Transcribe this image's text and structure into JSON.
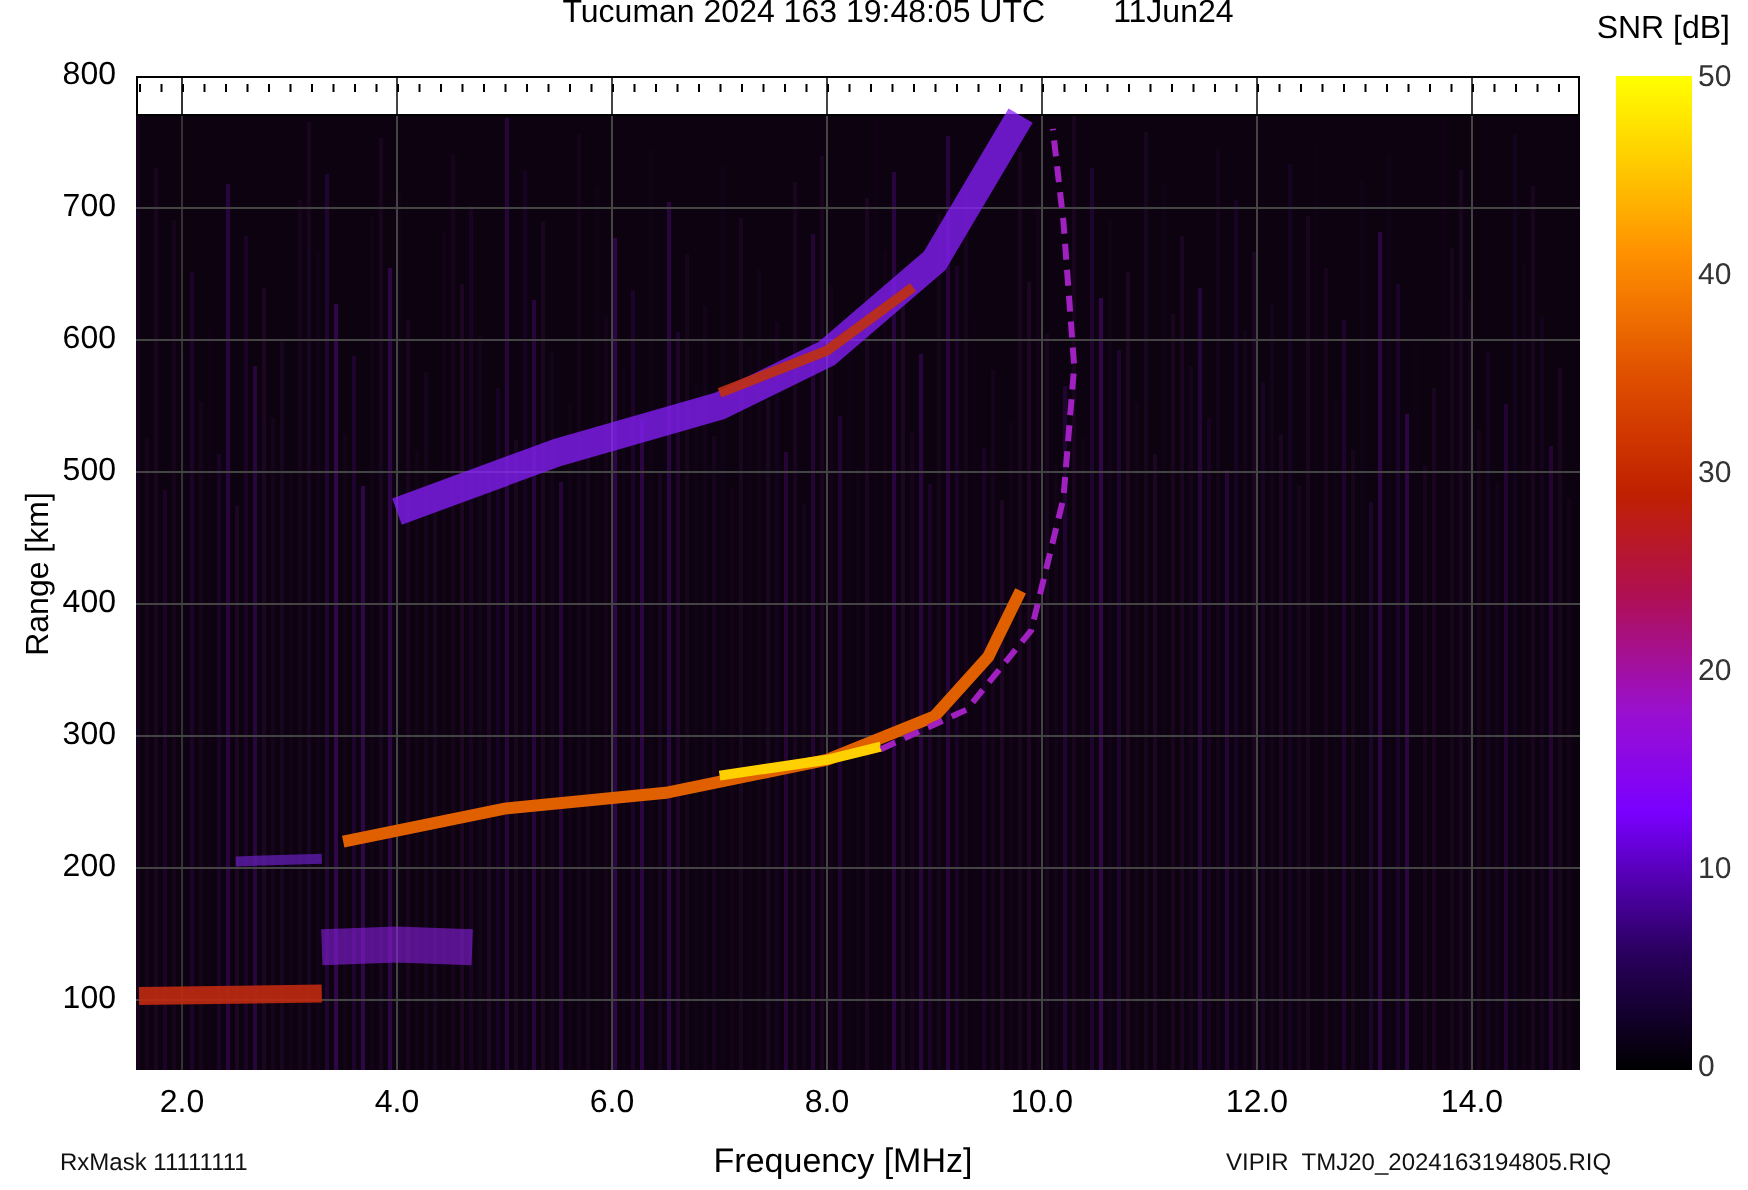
{
  "title": {
    "station": "Tucuman 2024 163 19:48:05 UTC",
    "date": "11Jun24"
  },
  "y_axis": {
    "label": "Range [km]",
    "ticks": [
      "800",
      "700",
      "600",
      "500",
      "400",
      "300",
      "200",
      "100"
    ]
  },
  "x_axis": {
    "label": "Frequency [MHz]",
    "ticks": [
      "2.0",
      "4.0",
      "6.0",
      "8.0",
      "10.0",
      "12.0",
      "14.0"
    ]
  },
  "colorbar": {
    "label": "SNR [dB]",
    "ticks": [
      "50",
      "40",
      "30",
      "20",
      "10",
      "0"
    ]
  },
  "footer": {
    "rx_mask": "RxMask 11111111",
    "file": "VIPIR  TMJ20_2024163194805.RIQ"
  }
}
